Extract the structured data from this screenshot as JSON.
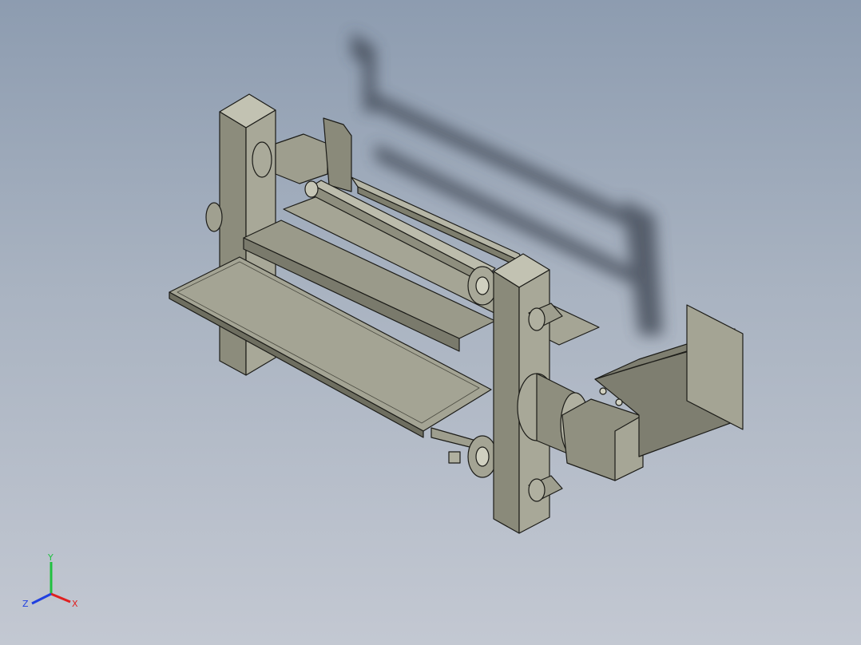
{
  "viewport": {
    "background_top": "#8d9cb0",
    "background_bottom": "#c3c8d2",
    "model_color": "#9d9d8e"
  },
  "triad": {
    "x_label": "X",
    "y_label": "Y",
    "z_label": "Z",
    "x_color": "#e02020",
    "y_color": "#20c040",
    "z_color": "#2040e0"
  }
}
